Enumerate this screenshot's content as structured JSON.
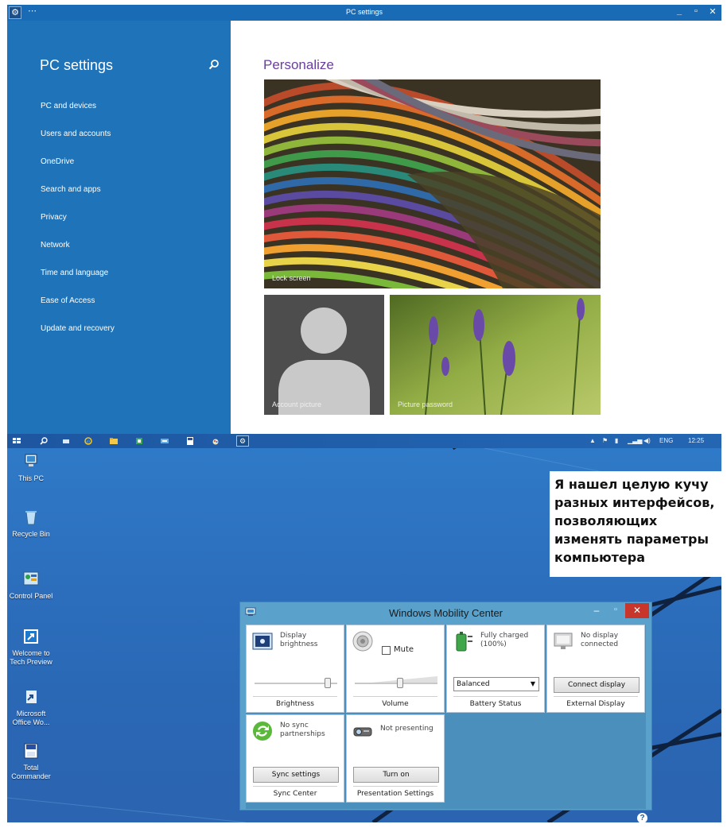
{
  "pc_settings": {
    "window_title": "PC settings",
    "sidebar": {
      "title": "PC settings",
      "items": [
        {
          "label": "PC and devices"
        },
        {
          "label": "Users and accounts"
        },
        {
          "label": "OneDrive"
        },
        {
          "label": "Search and apps"
        },
        {
          "label": "Privacy"
        },
        {
          "label": "Network"
        },
        {
          "label": "Time and language"
        },
        {
          "label": "Ease of Access"
        },
        {
          "label": "Update and recovery"
        }
      ]
    },
    "main": {
      "title": "Personalize",
      "tiles": {
        "lock_screen": "Lock screen",
        "account_picture": "Account picture",
        "picture_password": "Picture password"
      }
    },
    "taskbar": {
      "language": "ENG",
      "time": "12:25"
    }
  },
  "desktop": {
    "icons": [
      {
        "label": "This PC"
      },
      {
        "label": "Recycle Bin"
      },
      {
        "label": "Control Panel"
      },
      {
        "label": "Welcome to Tech Preview"
      },
      {
        "label": "Microsoft Office Wo..."
      },
      {
        "label": "Total Commander"
      }
    ],
    "note": "Я нашел целую кучу разных интерфейсов, позволяющих изменять параметры компьютера"
  },
  "mobility_center": {
    "title": "Windows Mobility Center",
    "panels": {
      "brightness": {
        "status": "Display brightness",
        "footer": "Brightness",
        "level": 0.92
      },
      "volume": {
        "mute_label": "Mute",
        "footer": "Volume",
        "level": 0.55
      },
      "battery": {
        "status": "Fully charged (100%)",
        "plan": "Balanced",
        "footer": "Battery Status"
      },
      "external_display": {
        "status": "No display connected",
        "button": "Connect display",
        "footer": "External Display"
      },
      "sync": {
        "status": "No sync partnerships",
        "button": "Sync settings",
        "footer": "Sync Center"
      },
      "presentation": {
        "status": "Not presenting",
        "button": "Turn on",
        "footer": "Presentation Settings"
      }
    }
  }
}
